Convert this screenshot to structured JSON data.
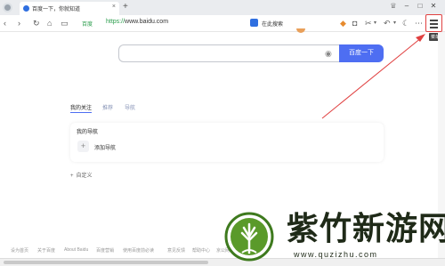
{
  "browser": {
    "tab_title": "百度一下，你就知道",
    "tab_close_glyph": "×",
    "new_tab_glyph": "+",
    "address": {
      "secure_label": "百度",
      "url_prefix": "https://",
      "url_host": "www.baidu.com"
    },
    "search_box_label": "在此搜索",
    "menu_tooltip": "菜单",
    "colors": {
      "accent": "#4e6ef2",
      "annotation_red": "#e04040",
      "secure_green": "#2a9d4b"
    }
  },
  "baidu": {
    "search_value": "",
    "search_button": "百度一下",
    "feed_tabs": [
      "我的关注",
      "推荐",
      "导航"
    ],
    "nav_card_title": "我的导航",
    "add_nav_label": "添加导航",
    "customize_label": "自定义"
  },
  "footer_links": [
    "设为首页",
    "关于百度",
    "About Baidu",
    "百度营销",
    "使用百度前必读",
    "意见反馈",
    "帮助中心",
    "京公网安备"
  ],
  "watermark": {
    "brand": "紫竹新游网",
    "url": "www.quzizhu.com"
  }
}
